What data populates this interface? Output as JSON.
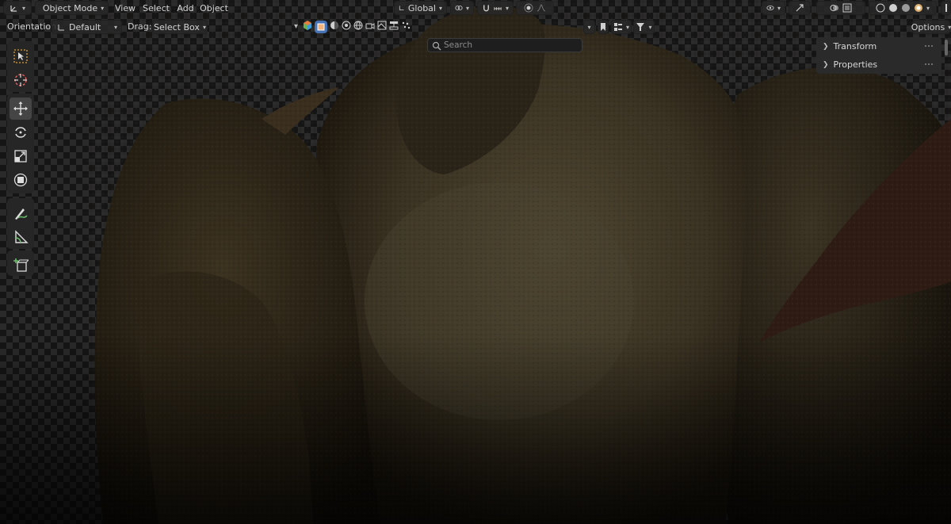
{
  "header": {
    "mode": "Object Mode",
    "menus": [
      "View",
      "Select",
      "Add",
      "Object"
    ],
    "transform_orientation": "Global"
  },
  "tool_settings": {
    "orientation_label": "Orientation:",
    "orientation_value": "Default",
    "drag_label": "Drag:",
    "drag_value": "Select Box",
    "search_placeholder": "Search",
    "options_label": "Options"
  },
  "sidebar": {
    "panels": [
      "Transform",
      "Properties"
    ]
  },
  "tools": [
    {
      "name": "select-box-icon",
      "selected": false
    },
    {
      "name": "cursor-icon",
      "selected": false
    },
    {
      "name": "move-icon",
      "selected": true
    },
    {
      "name": "rotate-icon",
      "selected": false
    },
    {
      "name": "scale-icon",
      "selected": false
    },
    {
      "name": "transform-icon",
      "selected": false
    },
    {
      "name": "annotate-icon",
      "selected": false
    },
    {
      "name": "measure-icon",
      "selected": false
    },
    {
      "name": "add-cube-icon",
      "selected": false
    }
  ],
  "colors": {
    "header_bg": "#2c2c2c",
    "accent": "#4772b3",
    "model_body": "#3f3522"
  }
}
